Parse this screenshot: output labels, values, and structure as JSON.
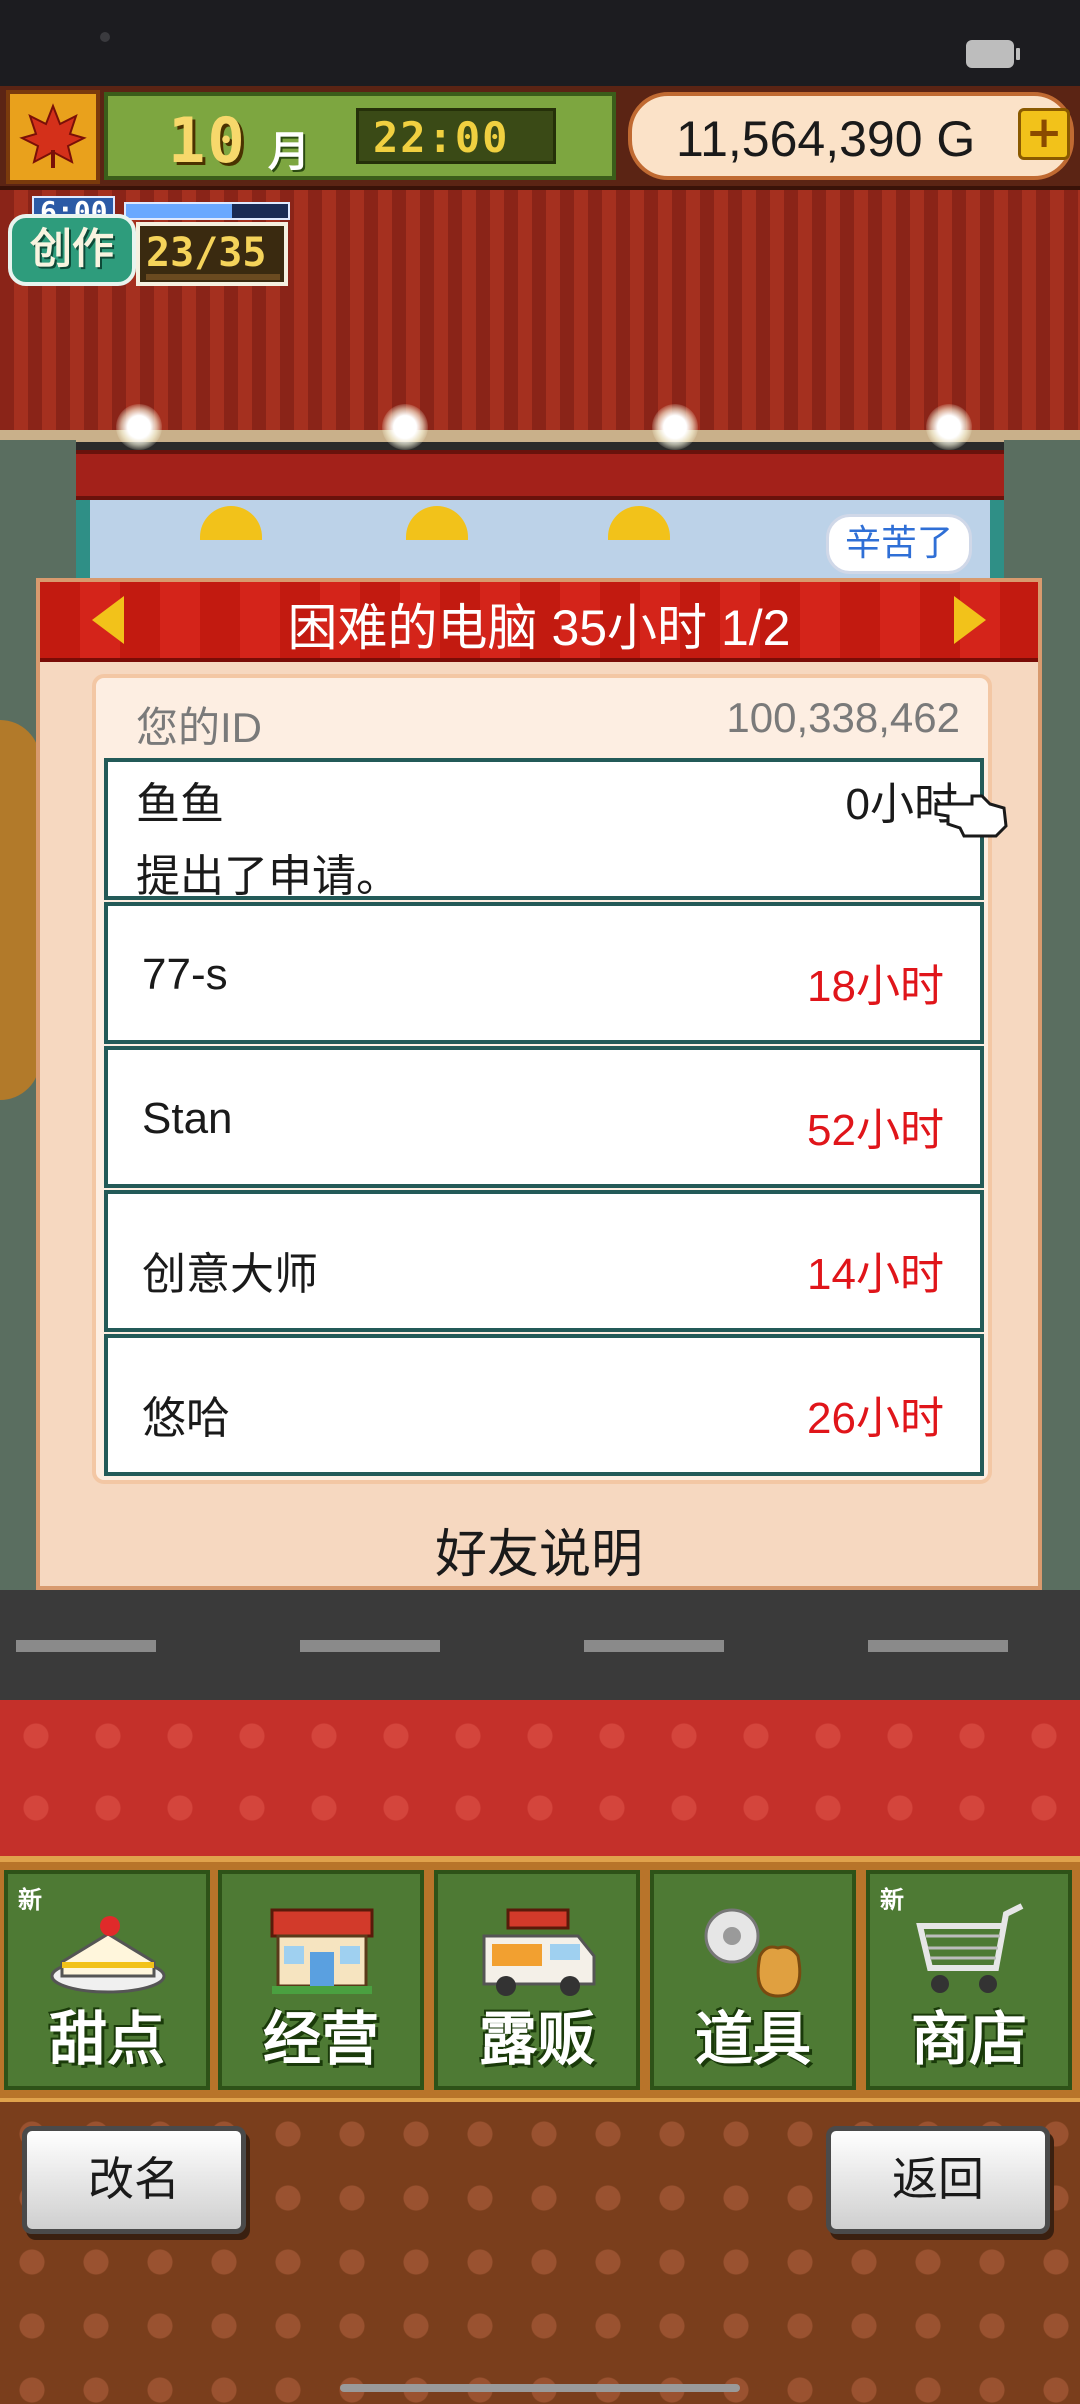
{
  "hud": {
    "month_number": "10",
    "month_label": "月",
    "time": "22:00",
    "money": "11,564,390 G",
    "money_plus": "+"
  },
  "create": {
    "label": "创作",
    "timer": "6:00",
    "count": "23/35",
    "progress": 0.657
  },
  "scene": {
    "greeting_bubble": "辛苦了"
  },
  "dialog": {
    "title": "困难的电脑  35小时 1/2",
    "id_label": "您的ID",
    "id_value": "100,338,462",
    "rows": [
      {
        "name": "鱼鱼",
        "hours": "0小时",
        "message": "提出了申请。"
      },
      {
        "name": "77-s",
        "hours": "18小时"
      },
      {
        "name": "Stan",
        "hours": "52小时"
      },
      {
        "name": "创意大师",
        "hours": "14小时"
      },
      {
        "name": "悠哈",
        "hours": "26小时"
      }
    ],
    "friend_help": "好友说明"
  },
  "menu": [
    {
      "label": "甜点",
      "new": "新"
    },
    {
      "label": "经营",
      "new": ""
    },
    {
      "label": "露贩",
      "new": ""
    },
    {
      "label": "道具",
      "new": ""
    },
    {
      "label": "商店",
      "new": "新"
    }
  ],
  "footer": {
    "rename": "改名",
    "back": "返回"
  },
  "colors": {
    "hours_highlight": "#e0151a",
    "header_red": "#c21a10",
    "row_border": "#235a58",
    "menu_green": "#4e7a34"
  },
  "icons": [
    "maple-leaf-icon",
    "cake-icon",
    "store-icon",
    "food-truck-icon",
    "gear-pouch-icon",
    "shopping-cart-icon",
    "pointing-hand-icon",
    "arrow-left-icon",
    "arrow-right-icon"
  ]
}
